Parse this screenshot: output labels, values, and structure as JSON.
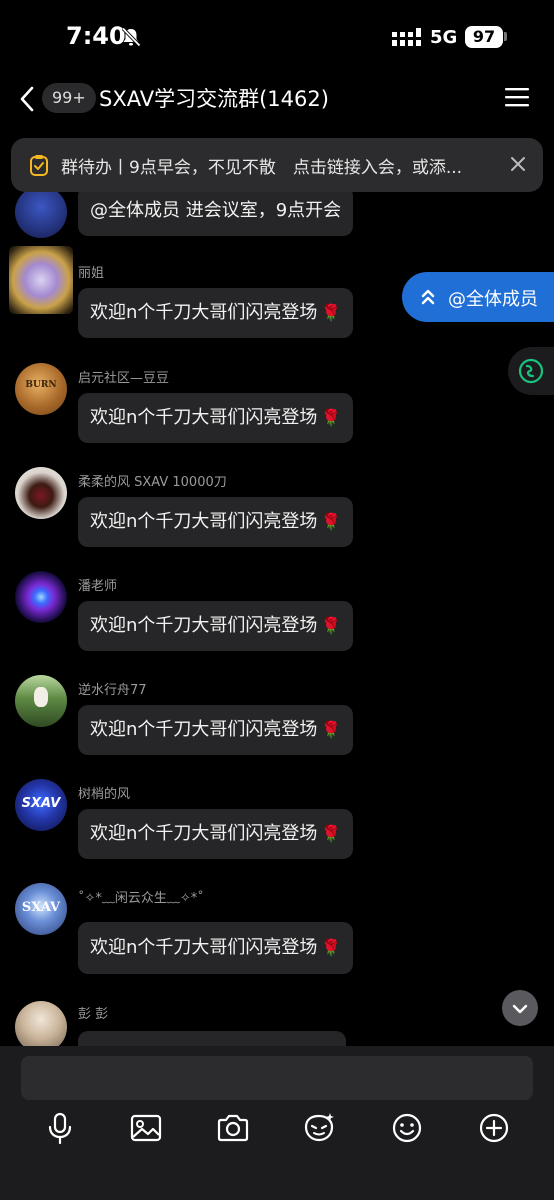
{
  "status_bar": {
    "time": "7:40",
    "network": "5G",
    "battery": "97"
  },
  "header": {
    "unread_badge": "99+",
    "title": "SXAV学习交流群(1462)"
  },
  "todo_banner": {
    "text": "群待办丨9点早会，不见不散　点击链接入会，或添..."
  },
  "messages": [
    {
      "sender": "",
      "text": "@全体成员 进会议室，9点开会",
      "rose": ""
    },
    {
      "sender": "丽姐",
      "text": "欢迎n个千刀大哥们闪亮登场",
      "rose": "🌹"
    },
    {
      "sender": "启元社区—豆豆",
      "text": "欢迎n个千刀大哥们闪亮登场",
      "rose": "🌹"
    },
    {
      "sender": "柔柔的风 SXAV 10000刀",
      "text": "欢迎n个千刀大哥们闪亮登场",
      "rose": "🌹"
    },
    {
      "sender": "潘老师",
      "text": "欢迎n个千刀大哥们闪亮登场",
      "rose": "🌹"
    },
    {
      "sender": "逆水行舟77",
      "text": "欢迎n个千刀大哥们闪亮登场",
      "rose": "🌹"
    },
    {
      "sender": "树梢的风",
      "text": "欢迎n个千刀大哥们闪亮登场",
      "rose": "🌹"
    },
    {
      "sender": "˚✧*﹏闲云众生﹏✧*˚",
      "text": "欢迎n个千刀大哥们闪亮登场",
      "rose": "🌹"
    },
    {
      "sender": "彭 彭",
      "text": "",
      "rose": ""
    }
  ],
  "avatars": {
    "burn_text": "BURN",
    "sxav_text": "SXAV"
  },
  "floating": {
    "mention_label": "@全体成员"
  },
  "input": {
    "value": "",
    "placeholder": ""
  },
  "toolbar": [
    "microphone-icon",
    "image-icon",
    "camera-icon",
    "ai-sticker-icon",
    "emoji-icon",
    "plus-icon"
  ],
  "colors": {
    "accent": "#1f6fd6",
    "bubble": "#262628",
    "background": "#000000",
    "ai_green": "#19c37d"
  }
}
